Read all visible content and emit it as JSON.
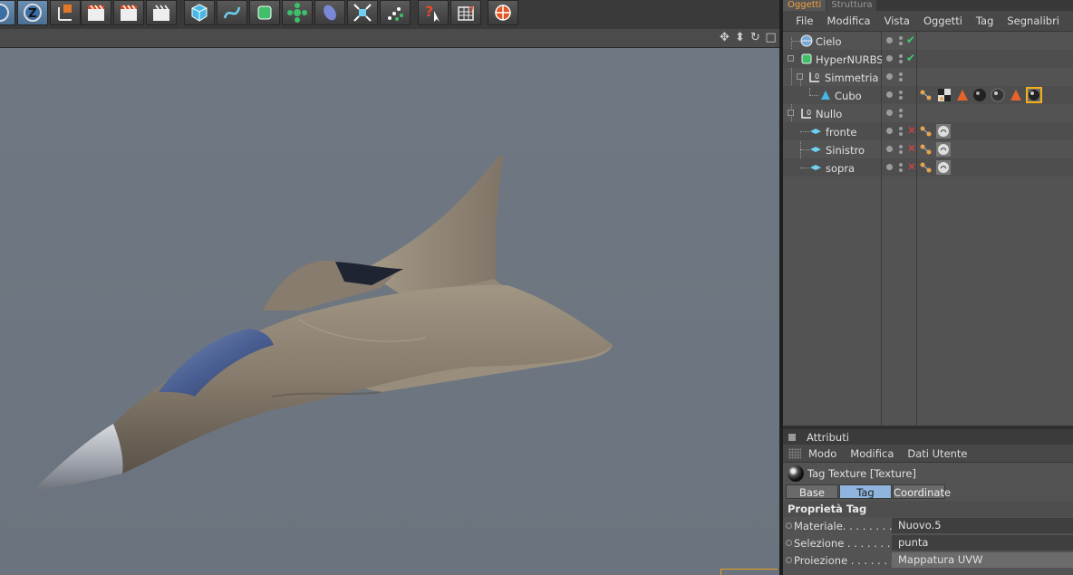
{
  "object_manager": {
    "tabs": [
      "Oggetti",
      "Struttura"
    ],
    "menu": [
      "File",
      "Modifica",
      "Vista",
      "Oggetti",
      "Tag",
      "Segnalibri"
    ],
    "objects": [
      {
        "name": "Cielo",
        "type": "sky",
        "depth": 0
      },
      {
        "name": "HyperNURBS",
        "type": "hypernurbs",
        "depth": 0
      },
      {
        "name": "Simmetria",
        "type": "null",
        "depth": 1
      },
      {
        "name": "Cubo",
        "type": "polygon",
        "depth": 2
      },
      {
        "name": "Nullo",
        "type": "null",
        "depth": 0
      },
      {
        "name": "fronte",
        "type": "plane",
        "depth": 1
      },
      {
        "name": "Sinistro",
        "type": "plane",
        "depth": 1
      },
      {
        "name": "sopra",
        "type": "plane",
        "depth": 1
      }
    ]
  },
  "attributes": {
    "title": "Attributi",
    "menu": [
      "Modo",
      "Modifica",
      "Dati Utente"
    ],
    "object_label": "Tag Texture [Texture]",
    "tabs": [
      "Base",
      "Tag",
      "Coordinate"
    ],
    "active_tab": "Tag",
    "section": "Proprietà Tag",
    "properties": [
      {
        "label": "Materiale. . . . . . . .",
        "value": "Nuovo.5"
      },
      {
        "label": "Selezione . . . . . . . . .",
        "value": "punta"
      },
      {
        "label": "Proiezione . . . . . . . .",
        "value": "Mappatura UVW"
      }
    ]
  },
  "colors": {
    "accent_orange": "#f3a23a",
    "active_tab_blue": "#8fb5df",
    "viewport_bg": "#6d7680",
    "check_green": "#37d06f",
    "x_red": "#e04040"
  }
}
